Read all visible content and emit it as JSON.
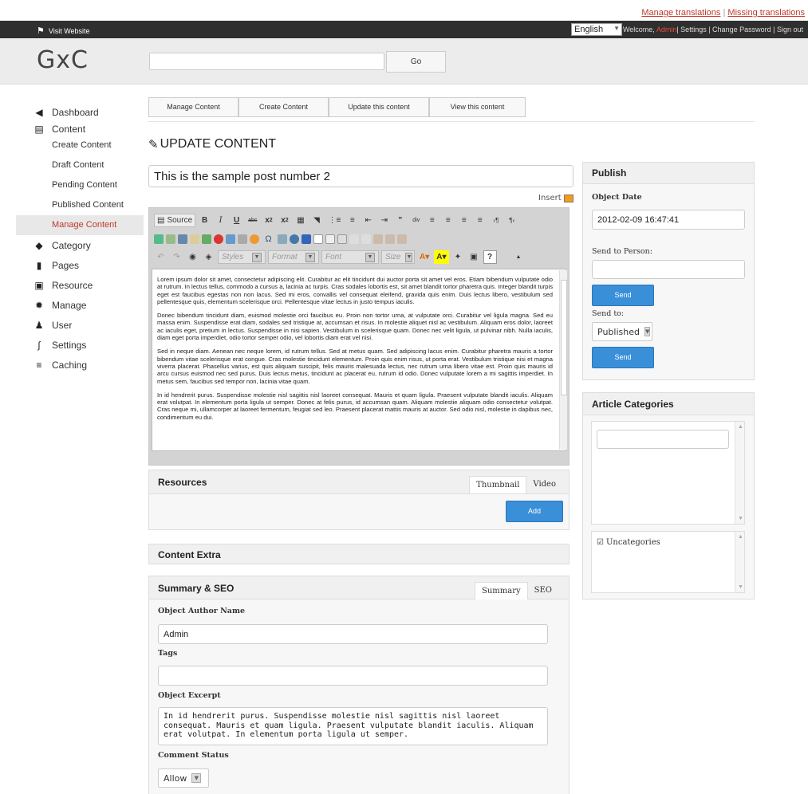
{
  "translations": {
    "manage": "Manage translations",
    "separator": "|",
    "missing": "Missing translations"
  },
  "topbar": {
    "visit": "Visit Website",
    "language": "English",
    "welcome": "Welcome,",
    "admin": "Admin",
    "settings": "| Settings",
    "change_password": "| Change Password",
    "sign_out": "| Sign out"
  },
  "header": {
    "logo": "GxC",
    "search_value": "",
    "go_label": "Go"
  },
  "sidebar": {
    "dashboard": "Dashboard",
    "content": "Content",
    "content_sub": [
      "Create Content",
      "Draft Content",
      "Pending Content",
      "Published Content",
      "Manage Content"
    ],
    "category": "Category",
    "pages": "Pages",
    "resource": "Resource",
    "manage": "Manage",
    "user": "User",
    "settings": "Settings",
    "caching": "Caching"
  },
  "buttons": {
    "manage": "Manage Content",
    "create": "Create Content",
    "update": "Update this content",
    "view": "View this content"
  },
  "page_title": "UPDATE CONTENT",
  "title_value": "This is the sample post number 2",
  "insert_label": "Insert",
  "editor": {
    "source": "Source",
    "styles": "Styles",
    "format": "Format",
    "font": "Font",
    "size": "Size",
    "paragraphs": [
      "Lorem ipsum dolor sit amet, consectetur adipiscing elit. Curabitur ac elit tincidunt dui auctor porta sit amet vel eros. Etiam bibendum vulputate odio at rutrum. In lectus tellus, commodo a cursus a, lacinia ac turpis. Cras sodales lobortis est, sit amet blandit tortor pharetra quis. Integer blandit turpis eget est faucibus egestas non non lacus. Sed mi eros, convallis vel consequat eleifend, gravida quis enim. Duis lectus libero, vestibulum sed pellentesque quis, elementum scelerisque orci. Pellentesque vitae lectus in justo tempus iaculis.",
      "Donec bibendum tincidunt diam, euismod molestie orci faucibus eu. Proin non tortor urna, at vulputate orci. Curabitur vel ligula magna. Sed eu massa enim. Suspendisse erat diam, sodales sed tristique at, accumsan et risus. In molestie aliquet nisl ac vestibulum. Aliquam eros dolor, laoreet ac iaculis eget, pretium in lectus. Suspendisse in nisi sapien. Vestibulum in scelerisque quam. Donec nec velit ligula, ut pulvinar nibh. Nulla iaculis, diam eget porta imperdiet, odio tortor semper odio, vel lobortis diam erat vel nisi.",
      "Sed in neque diam. Aenean nec neque lorem, id rutrum tellus. Sed at metus quam. Sed adipiscing lacus enim. Curabitur pharetra mauris a tortor bibendum vitae scelerisque erat congue. Cras molestie tincidunt elementum. Proin quis enim risus, ut porta erat. Vestibulum tristique nisi et magna viverra placerat. Phasellus varius, est quis aliquam suscipit, felis mauris malesuada lectus, nec rutrum urna libero vitae est. Proin quis mauris id arcu cursus euismod nec sed purus. Duis lectus metus, tincidunt ac placerat eu, rutrum id odio. Donec vulputate lorem a mi sagittis imperdiet. In metus sem, faucibus sed tempor non, lacinia vitae quam.",
      "In id hendrerit purus. Suspendisse molestie nisl sagittis nisl laoreet consequat. Mauris et quam ligula. Praesent vulputate blandit iaculis. Aliquam erat volutpat. In elementum porta ligula ut semper. Donec at felis purus, id accumsan quam. Aliquam molestie aliquam odio consectetur volutpat. Cras neque mi, ullamcorper at laoreet fermentum, feugiat sed leo. Praesent placerat mattis mauris at auctor. Sed odio nisl, molestie in dapibus nec, condimentum eu dui."
    ]
  },
  "resources": {
    "title": "Resources",
    "tab_thumbnail": "Thumbnail",
    "tab_video": "Video",
    "add": "Add"
  },
  "content_extra": {
    "title": "Content Extra"
  },
  "seo": {
    "title": "Summary & SEO",
    "tab_summary": "Summary",
    "tab_seo": "SEO",
    "author_label": "Object Author Name",
    "author_value": "Admin",
    "tags_label": "Tags",
    "tags_value": "",
    "excerpt_label": "Object Excerpt",
    "excerpt_value": "In id hendrerit purus. Suspendisse molestie nisl sagittis nisl laoreet consequat. Mauris et quam ligula. Praesent vulputate blandit iaculis. Aliquam erat volutpat. In elementum porta ligula ut semper.",
    "comment_label": "Comment Status",
    "comment_value": "Allow"
  },
  "publish": {
    "title": "Publish",
    "date_label": "Object Date",
    "date_value": "2012-02-09 16:47:41",
    "person_label": "Send to Person:",
    "person_value": "",
    "send": "Send",
    "send_to_label": "Send to:",
    "send_to_value": "Published"
  },
  "categories": {
    "title": "Article Categories",
    "item": "Uncategories"
  },
  "colors": {
    "accent_red": "#c0392b",
    "button_blue": "#3a8fd9",
    "topbar": "#2f2f2f"
  }
}
